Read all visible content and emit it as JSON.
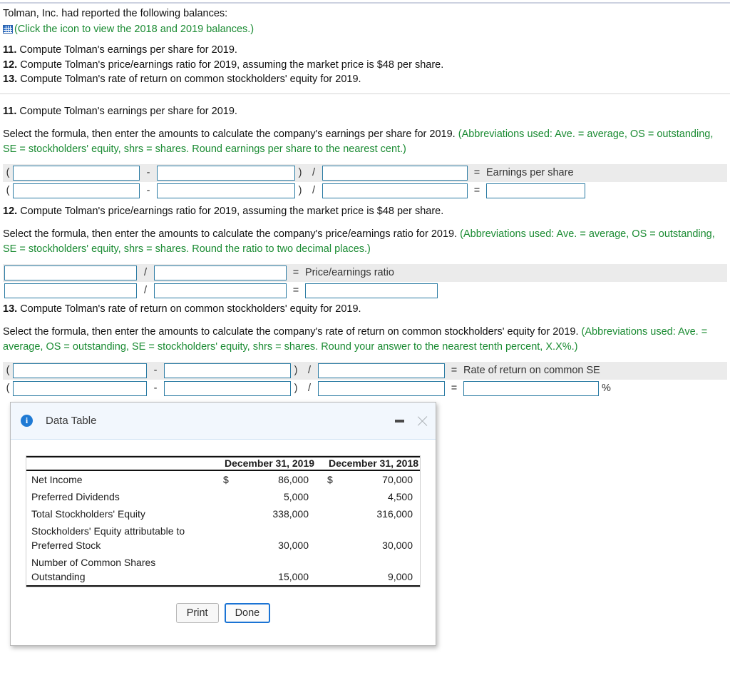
{
  "intro": {
    "line1": "Tolman, Inc. had reported the following balances:",
    "icon": "spreadsheet-grid-icon",
    "link_text": "(Click the icon to view the 2018 and 2019 balances.)",
    "link_color": "#1a8b32"
  },
  "question_list": [
    {
      "num": "11.",
      "text": " Compute Tolman's earnings per share for 2019."
    },
    {
      "num": "12.",
      "text": " Compute Tolman's price/earnings ratio for 2019, assuming the market price is $48 per share."
    },
    {
      "num": "13.",
      "text": " Compute Tolman's rate of return on common stockholders' equity for 2019."
    }
  ],
  "sections": [
    {
      "id": "q11",
      "heading_num": "11.",
      "heading_text": " Compute Tolman's earnings per share for 2019.",
      "prompt_black": "Select the formula, then enter the amounts to calculate the company's earnings per share for 2019. ",
      "prompt_green": "(Abbreviations used: Ave. = average, OS = outstanding, SE = stockholders' equity, shrs = shares. Round earnings per share to the nearest cent.)",
      "result_label": "Earnings per share",
      "open_paren": "(",
      "minus": "-",
      "close_paren": ")",
      "divide": "/",
      "equals": "="
    },
    {
      "id": "q12",
      "heading_num": "12.",
      "heading_text": " Compute Tolman's price/earnings ratio for 2019, assuming the market price is $48 per share.",
      "prompt_black": "Select the formula, then enter the amounts to calculate the company's price/earnings ratio for 2019. ",
      "prompt_green": "(Abbreviations used: Ave. = average, OS = outstanding, SE = stockholders' equity, shrs = shares. Round the ratio to two decimal places.)",
      "result_label": "Price/earnings ratio",
      "divide": "/",
      "equals": "="
    },
    {
      "id": "q13",
      "heading_num": "13.",
      "heading_text": " Compute Tolman's rate of return on common stockholders' equity for 2019.",
      "prompt_black": "Select the formula, then enter the amounts to calculate the company's rate of return on common stockholders' equity for 2019. ",
      "prompt_green": "(Abbreviations used: Ave. = average, OS = outstanding, SE = stockholders' equity, shrs = shares. Round your answer to the nearest tenth percent, X.X%.)",
      "result_label": "Rate of return on common SE",
      "open_paren": "(",
      "minus": "-",
      "close_paren": ")",
      "divide": "/",
      "equals": "=",
      "percent": "%"
    }
  ],
  "dialog": {
    "title": "Data Table",
    "info_glyph": "i",
    "minimize_label": "minimize",
    "close_label": "close",
    "table": {
      "col_headers": [
        "",
        "December 31,\n2019",
        "December 31,\n2018"
      ],
      "rows": [
        {
          "label": "Net Income",
          "cur_2019": "$",
          "val_2019": "86,000",
          "cur_2018": "$",
          "val_2018": "70,000"
        },
        {
          "label": "Preferred Dividends",
          "cur_2019": "",
          "val_2019": "5,000",
          "cur_2018": "",
          "val_2018": "4,500"
        },
        {
          "label": "Total Stockholders' Equity",
          "cur_2019": "",
          "val_2019": "338,000",
          "cur_2018": "",
          "val_2018": "316,000"
        },
        {
          "label": "Stockholders' Equity attributable to\nPreferred Stock",
          "cur_2019": "",
          "val_2019": "30,000",
          "cur_2018": "",
          "val_2018": "30,000"
        },
        {
          "label": "Number of Common Shares\nOutstanding",
          "cur_2019": "",
          "val_2019": "15,000",
          "cur_2018": "",
          "val_2018": "9,000"
        }
      ]
    },
    "buttons": {
      "print": "Print",
      "done": "Done"
    }
  },
  "colors": {
    "input_border": "#2b7ba3",
    "row_shade": "#ebebeb",
    "green_text": "#1a8b32",
    "dialog_header": "#f2f7fd",
    "focus_blue": "#1a73d4"
  }
}
